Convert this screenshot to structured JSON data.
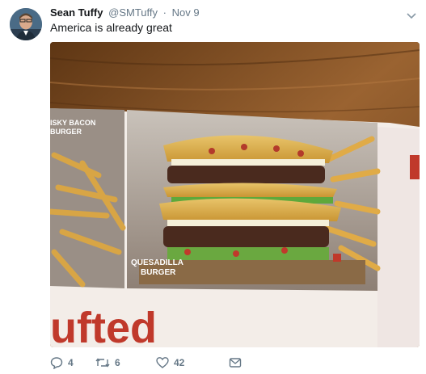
{
  "tweet": {
    "author_name": "Sean Tuffy",
    "handle": "@SMTuffy",
    "separator": "·",
    "time": "Nov 9",
    "text": "America is already great"
  },
  "media": {
    "menu_item_left": "…ISKY BACON BURGER",
    "menu_item_left_line1": "ISKY BACON",
    "menu_item_left_line2": "BURGER",
    "menu_item_main_line1": "QUESADILLA",
    "menu_item_main_line2": "BURGER",
    "bottom_text": "ufted"
  },
  "actions": {
    "reply_count": "4",
    "retweet_count": "6",
    "like_count": "42"
  },
  "colors": {
    "text_primary": "#14171a",
    "text_secondary": "#657786",
    "menu_red": "#c0392b"
  },
  "icons": [
    "caret-down-icon",
    "reply-icon",
    "retweet-icon",
    "like-icon",
    "message-icon"
  ]
}
